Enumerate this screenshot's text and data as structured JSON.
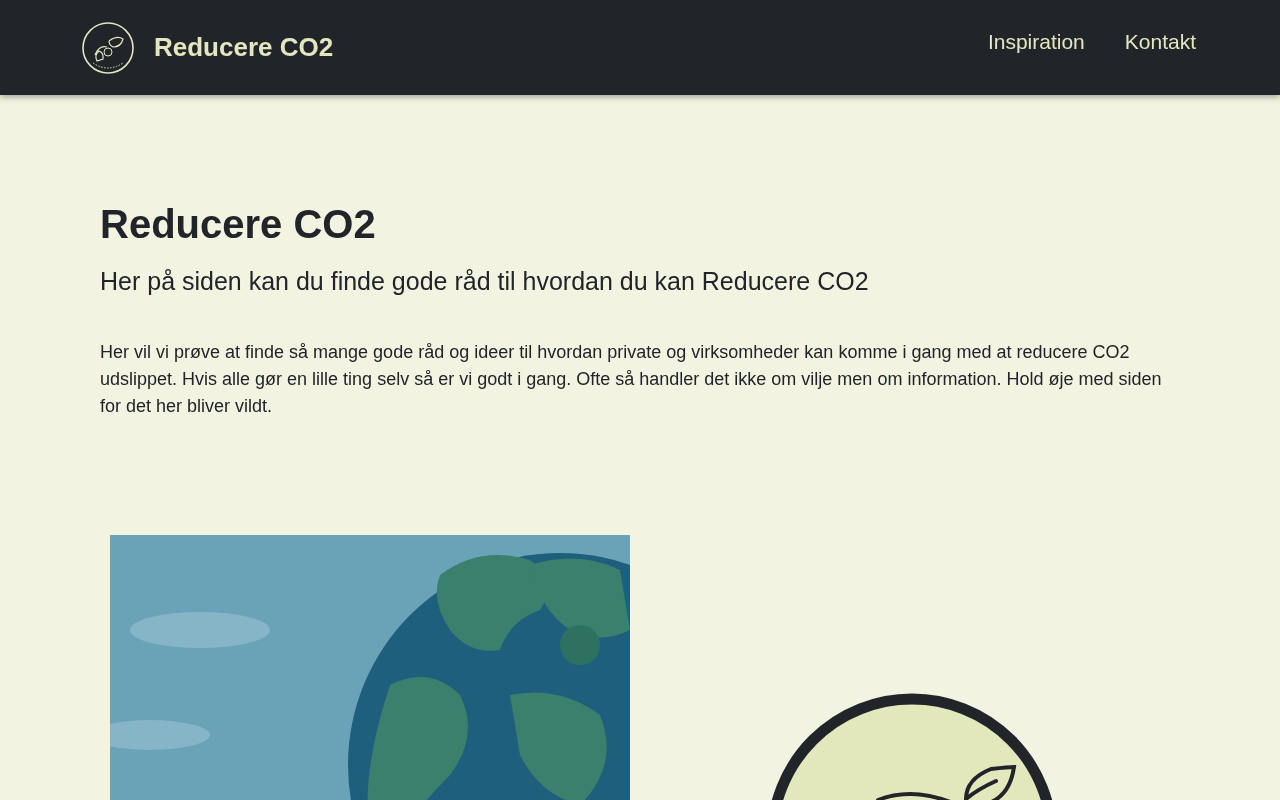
{
  "header": {
    "brand": "Reducere CO2",
    "nav": [
      {
        "label": "Inspiration"
      },
      {
        "label": "Kontakt"
      }
    ]
  },
  "hero": {
    "title": "Reducere CO2",
    "subtitle": "Her på siden kan du finde gode råd til hvordan du kan Reducere CO2",
    "body": "Her vil vi prøve at finde så mange gode råd og ideer til hvordan private og virksomheder kan komme i gang med at reducere CO2 udslippet. Hvis alle gør en lille ting selv så er vi godt i gang. Ofte så handler det ikke om vilje men om information. Hold øje med siden for det her bliver vildt."
  },
  "media": [
    {
      "kind": "picture"
    },
    {
      "kind": "logo"
    }
  ]
}
